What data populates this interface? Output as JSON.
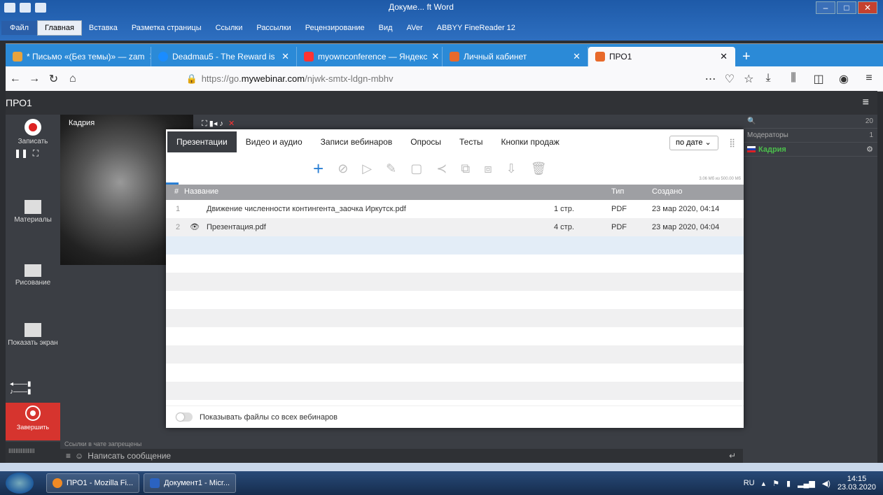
{
  "word": {
    "title": "Докуме... ft Word",
    "tabs": [
      "Файл",
      "Главная",
      "Вставка",
      "Разметка страницы",
      "Ссылки",
      "Рассылки",
      "Рецензирование",
      "Вид",
      "AVer",
      "ABBYY FineReader 12"
    ]
  },
  "browser": {
    "tabs": [
      {
        "label": "* Письмо «(Без темы)» — zam",
        "color": "#e8a33d"
      },
      {
        "label": "Deadmau5 - The Reward is",
        "color": "#1a8cff"
      },
      {
        "label": "myownconference — Яндекс",
        "color": "#f33"
      },
      {
        "label": "Личный кабинет",
        "color": "#e86a2b"
      },
      {
        "label": "ПРО1",
        "color": "#e86a2b"
      }
    ],
    "url_prefix": "https://go.",
    "url_domain": "mywebinar.com",
    "url_path": "/njwk-smtx-ldgn-mbhv"
  },
  "app": {
    "title": "ПРО1",
    "sidebar": {
      "record": "Записать",
      "materials": "Материалы",
      "drawing": "Рисование",
      "share": "Показать экран",
      "finish": "Завершить"
    },
    "video_name": "Кадрия",
    "chat": {
      "note": "Ссылки в чате запрещены",
      "placeholder": "Написать сообщение"
    },
    "right": {
      "count": "20",
      "moderators": "Модераторы",
      "moderators_count": "1",
      "user": "Кадрия"
    }
  },
  "dialog": {
    "tabs": [
      "Презентации",
      "Видео и аудио",
      "Записи вебинаров",
      "Опросы",
      "Тесты",
      "Кнопки продаж"
    ],
    "sort": "по дате",
    "quota": "3.06 Мб из 500.00 Мб",
    "headers": {
      "num": "#",
      "name": "Название",
      "type": "Тип",
      "created": "Создано"
    },
    "files": [
      {
        "num": "1",
        "name": "Движение численности контингента_заочка Иркутск.pdf",
        "pages": "1 стр.",
        "type": "PDF",
        "created": "23 мар 2020, 04:14"
      },
      {
        "num": "2",
        "name": "Презентация.pdf",
        "pages": "4 стр.",
        "type": "PDF",
        "created": "23 мар 2020, 04:04"
      }
    ],
    "footer": "Показывать файлы со всех вебинаров"
  },
  "taskbar": {
    "items": [
      "ПРО1 - Mozilla Fi...",
      "Документ1 - Micr..."
    ],
    "lang": "RU",
    "time": "14:15",
    "date": "23.03.2020"
  }
}
